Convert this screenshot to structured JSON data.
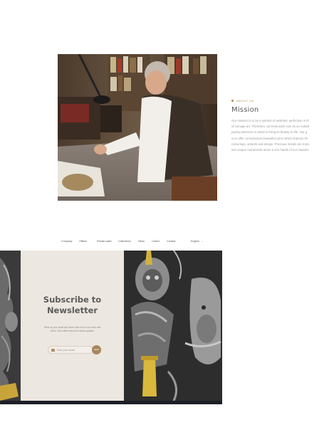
{
  "about": {
    "eyebrow": "ABOUT US",
    "title": "Mission",
    "body_lines": [
      "Our mission is to be a symbol of aesthetic perfection in th",
      "of coinage art. Therefore, we treat each coin as an individ",
      "paying attention to detail to bring its beauty to life. Our g",
      "is to offer connoisseurs beautiful coins which impress thr",
      "colourings, artwork and design. Precious metals are trans",
      "into unique numismatic items in the hands of our masters"
    ]
  },
  "nav": {
    "items": [
      "Company",
      "Offices",
      "Private sales",
      "Collections",
      "News",
      "Career",
      "Contact"
    ],
    "language": "English"
  },
  "newsletter": {
    "title_lines": [
      "Subscribe to",
      "Newsletter"
    ],
    "description_lines": [
      "Send us your email and never miss out on our news and",
      "offers. Get notified about the latest updates."
    ],
    "email_placeholder": "Enter your email",
    "submit_label": "SEND"
  },
  "colors": {
    "accent": "#a9865b",
    "panel": "#ede7e1",
    "footer": "#1c1f27"
  },
  "icons": [
    "mail-icon",
    "chevron-down-icon"
  ]
}
